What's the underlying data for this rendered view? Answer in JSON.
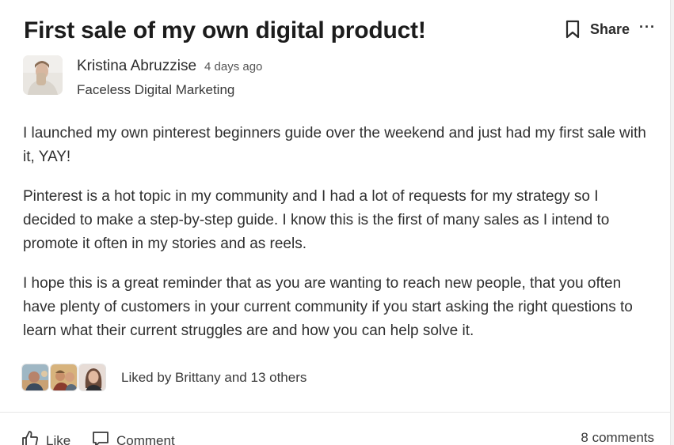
{
  "post": {
    "title": "First sale of my own digital product!",
    "share_label": "Share",
    "more_label": "···",
    "author": {
      "name": "Kristina Abruzzise",
      "time_ago": "4 days ago",
      "category": "Faceless Digital Marketing"
    },
    "paragraphs": [
      "I launched my own pinterest beginners guide over the weekend and just had my first sale with it, YAY!",
      "Pinterest is a hot topic in my community and I had a lot of requests for my strategy so I decided to make a step-by-step guide. I know this is the first of many sales as I intend to promote it often in my stories and as reels.",
      "I hope this is a great reminder that as you are wanting to reach new people, that you often have plenty of customers in your current community if you start asking the right questions to learn what their current struggles are and how you can help solve it."
    ],
    "likes_text": "Liked by Brittany and 13 others"
  },
  "footer": {
    "like_label": "Like",
    "comment_label": "Comment",
    "comments_count": "8 comments"
  },
  "icons": {
    "bookmark": "bookmark-icon",
    "thumbs_up": "thumbs-up-icon",
    "comment": "comment-icon"
  }
}
